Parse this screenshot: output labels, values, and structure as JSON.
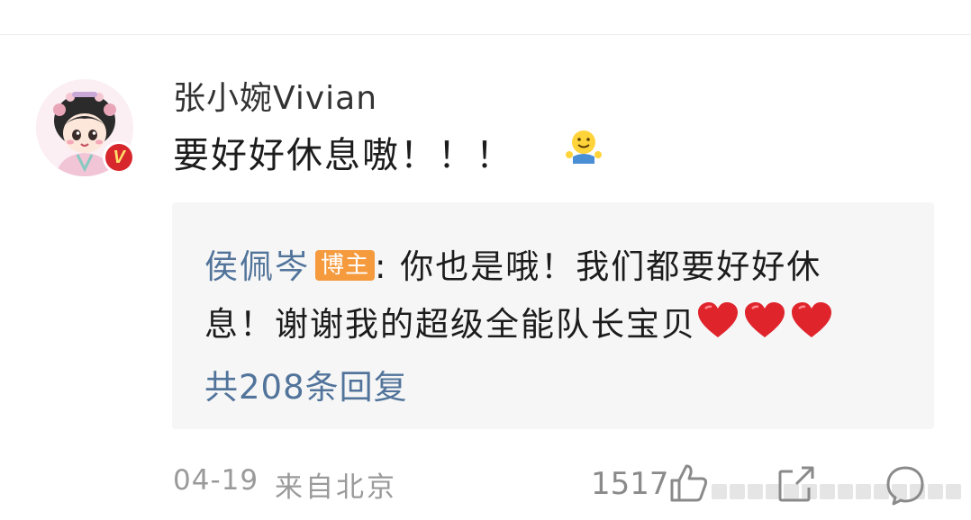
{
  "comment": {
    "username": "张小婉Vivian",
    "text": "要好好休息嗷！！！",
    "emoji": "smile-shrug-emoji",
    "avatar": "user-avatar",
    "verified_badge": "V"
  },
  "reply": {
    "author": "侯佩岑",
    "author_tag": "博主",
    "separator": ":",
    "text_line1": " 你也是哦！我们都要好好休",
    "text_line2": "息！谢谢我的超级全能队长宝贝",
    "hearts": [
      "red-heart-emoji",
      "red-heart-emoji",
      "red-heart-emoji"
    ],
    "count_label": "共208条回复"
  },
  "footer": {
    "date": "04-19",
    "location": "来自北京",
    "like_count": "1517"
  },
  "icons": {
    "like": "thumbs-up-icon",
    "share": "share-icon",
    "comment": "comment-icon"
  },
  "colors": {
    "link_blue": "#52749b",
    "tag_orange": "#f59a3d",
    "verified_red": "#d8262d",
    "reply_bg": "#f6f6f6",
    "meta_gray": "#9a9a9a"
  }
}
